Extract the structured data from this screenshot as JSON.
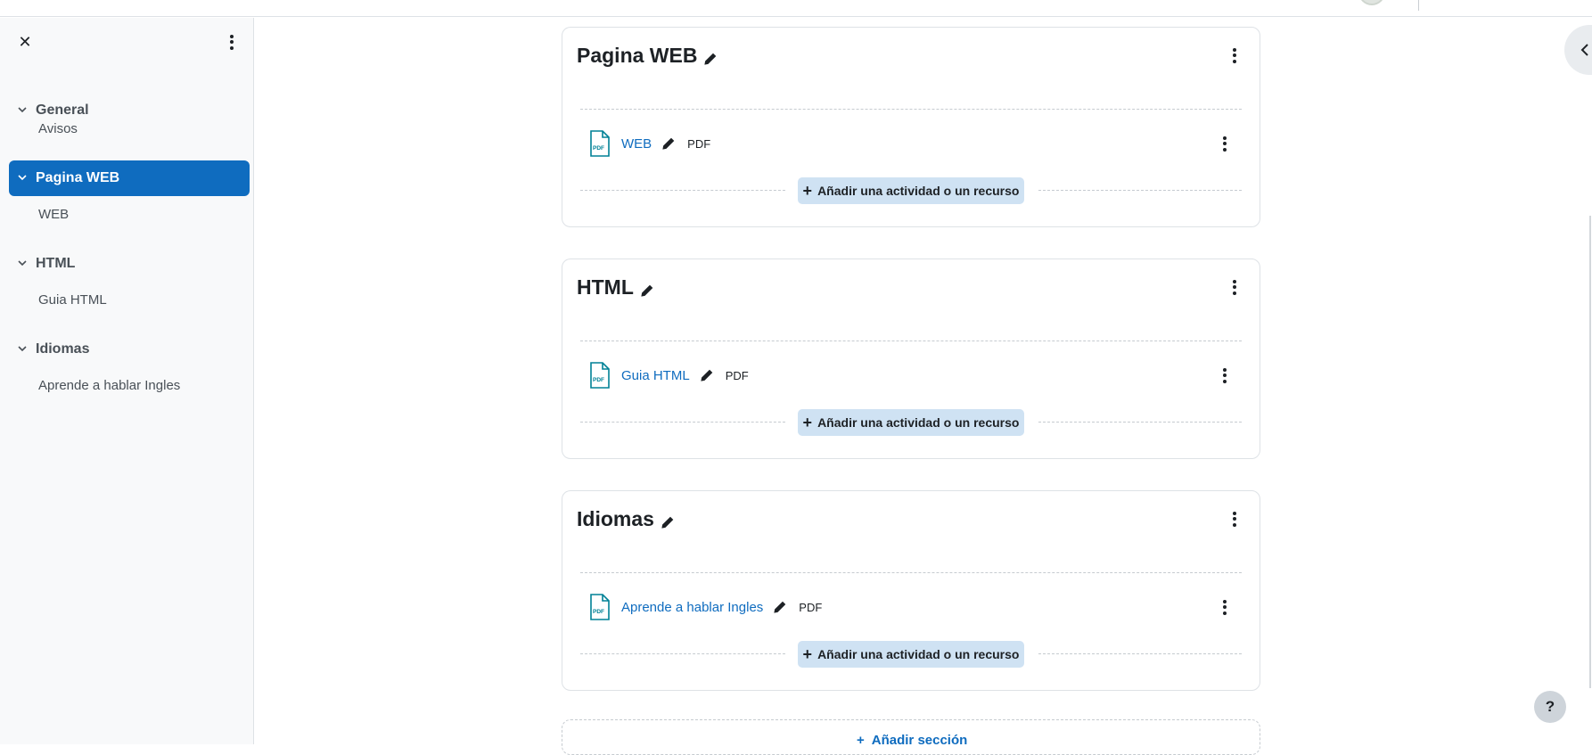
{
  "drawer": {
    "close_icon": "close-icon",
    "sections": [
      {
        "label": "General",
        "items": [
          "Avisos"
        ],
        "active": false
      },
      {
        "label": "Pagina WEB",
        "items": [
          "WEB"
        ],
        "active": true
      },
      {
        "label": "HTML",
        "items": [
          "Guia HTML"
        ],
        "active": false
      },
      {
        "label": "Idiomas",
        "items": [
          "Aprende a hablar Ingles"
        ],
        "active": false
      }
    ]
  },
  "sections": [
    {
      "title": "Pagina WEB",
      "activity": {
        "name": "WEB",
        "type": "PDF"
      },
      "add_label": "Añadir una actividad o un recurso"
    },
    {
      "title": "HTML",
      "activity": {
        "name": "Guia HTML",
        "type": "PDF"
      },
      "add_label": "Añadir una actividad o un recurso"
    },
    {
      "title": "Idiomas",
      "activity": {
        "name": "Aprende a hablar Ingles",
        "type": "PDF"
      },
      "add_label": "Añadir una actividad o un recurso"
    }
  ],
  "add_section": {
    "label": "Añadir sección",
    "plus": "+"
  },
  "help": {
    "label": "?"
  },
  "colors": {
    "accent": "#0f6cbf",
    "add_button_bg": "#cfe2f3",
    "drawer_bg": "#f8f9fa"
  }
}
